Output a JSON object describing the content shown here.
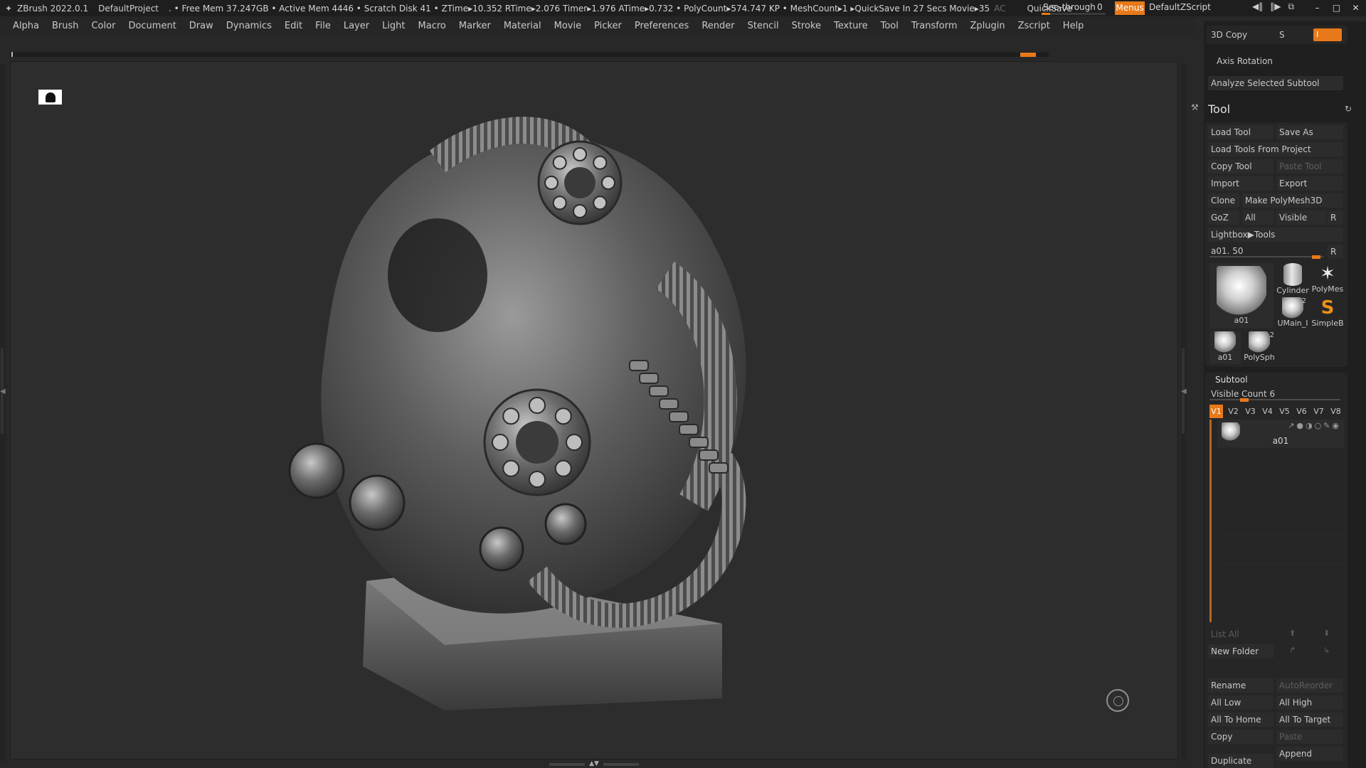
{
  "titlebar": {
    "app": "ZBrush 2022.0.1",
    "project": "DefaultProject",
    "stats": ". • Free Mem 37.247GB • Active Mem 4446 • Scratch Disk 41 •  ZTime▸10.352 RTime▸2.076 Timer▸1.976 ATime▸0.732 • PolyCount▸574.747 KP • MeshCount▸1  ▸QuickSave In 27 Secs Movie▸35",
    "stats_tail": "AC",
    "quicksave": "QuickSave",
    "see_through_label": "See-through",
    "see_through_value": "0",
    "see_through_fraction": 0.13,
    "menus_label": "Menus",
    "zscript_label": "DefaultZScript"
  },
  "menubar": [
    "Alpha",
    "Brush",
    "Color",
    "Document",
    "Draw",
    "Dynamics",
    "Edit",
    "File",
    "Layer",
    "Light",
    "Macro",
    "Marker",
    "Material",
    "Movie",
    "Picker",
    "Preferences",
    "Render",
    "Stencil",
    "Stroke",
    "Texture",
    "Tool",
    "Transform",
    "Zplugin",
    "Zscript",
    "Help"
  ],
  "panel": {
    "copy3d": "3D Copy",
    "copy_s": "S",
    "copy_field": "I",
    "axis_rotation": "Axis Rotation",
    "analyze": "Analyze Selected Subtool",
    "tool_header": "Tool",
    "load_tool": "Load Tool",
    "save_as": "Save As",
    "load_from_project": "Load Tools From Project",
    "copy_tool": "Copy Tool",
    "paste_tool": "Paste Tool",
    "import": "Import",
    "export": "Export",
    "clone": "Clone",
    "make_polymesh": "Make PolyMesh3D",
    "goz": "GoZ",
    "all": "All",
    "visible": "Visible",
    "r": "R",
    "lightbox": "Lightbox▶Tools",
    "tool_slider_label": "a01. 50",
    "tool_slider_fraction": 0.97,
    "thumbs": {
      "main": "a01",
      "cylinder": "Cylinder",
      "polymesh": "PolyMes",
      "umain": "UMain_I",
      "umain_badge": "2",
      "simpleb": "SimpleB",
      "small_a01": "a01",
      "polysph": "PolySph",
      "polysph_badge": "2"
    },
    "subtool_header": "Subtool",
    "visible_count": "Visible Count 6",
    "visible_count_fraction": 0.25,
    "vtabs": [
      "V1",
      "V2",
      "V3",
      "V4",
      "V5",
      "V6",
      "V7",
      "V8"
    ],
    "subtool_item": "a01",
    "list_all": "List All",
    "new_folder": "New Folder",
    "rename": "Rename",
    "autoreorder": "AutoReorder",
    "all_low": "All Low",
    "all_high": "All High",
    "all_to_home": "All To Home",
    "all_to_target": "All To Target",
    "copy": "Copy",
    "paste": "Paste",
    "append": "Append",
    "duplicate": "Duplicate"
  },
  "colors": {
    "accent": "#e8791a",
    "panel_bg": "#1f1f1f",
    "canvas_bg": "#2d2d2d"
  }
}
